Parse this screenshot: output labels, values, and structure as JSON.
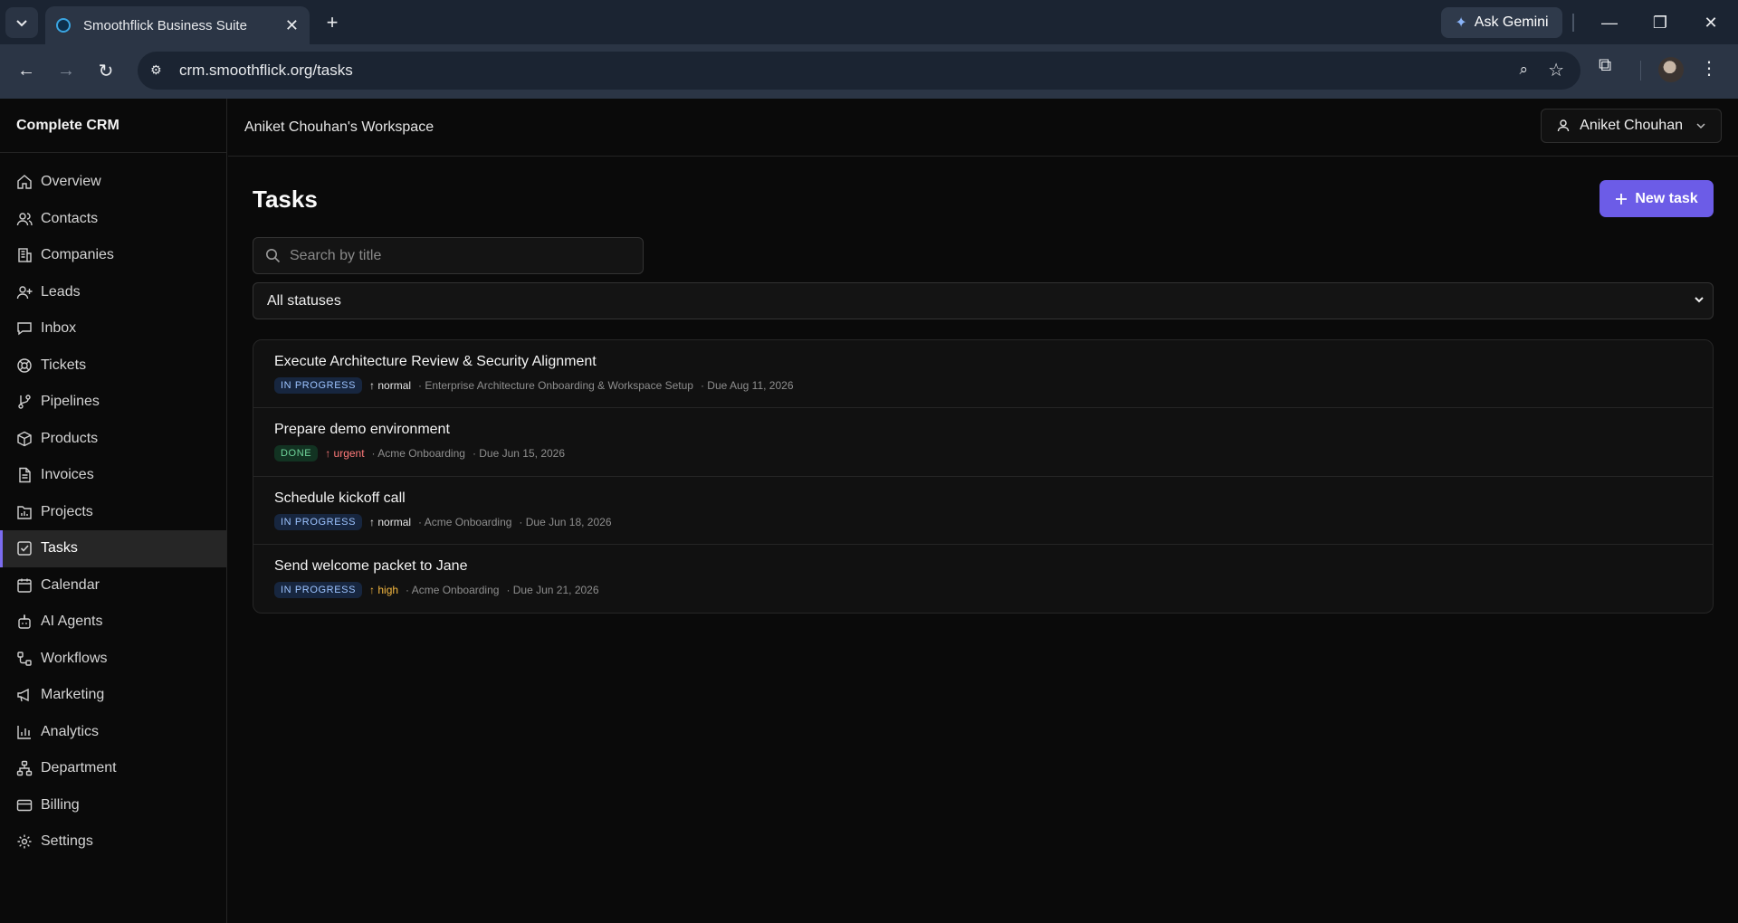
{
  "browser": {
    "tab_title": "Smoothflick Business Suite",
    "url": "crm.smoothflick.org/tasks",
    "gemini_label": "Ask Gemini"
  },
  "sidebar": {
    "brand": "Complete CRM",
    "items": [
      {
        "label": "Overview",
        "icon": "home-icon"
      },
      {
        "label": "Contacts",
        "icon": "users-icon"
      },
      {
        "label": "Companies",
        "icon": "building-icon"
      },
      {
        "label": "Leads",
        "icon": "user-plus-icon"
      },
      {
        "label": "Inbox",
        "icon": "message-icon"
      },
      {
        "label": "Tickets",
        "icon": "lifebuoy-icon"
      },
      {
        "label": "Pipelines",
        "icon": "git-branch-icon"
      },
      {
        "label": "Products",
        "icon": "package-icon"
      },
      {
        "label": "Invoices",
        "icon": "file-text-icon"
      },
      {
        "label": "Projects",
        "icon": "folder-chart-icon"
      },
      {
        "label": "Tasks",
        "icon": "check-square-icon"
      },
      {
        "label": "Calendar",
        "icon": "calendar-icon"
      },
      {
        "label": "AI Agents",
        "icon": "bot-icon"
      },
      {
        "label": "Workflows",
        "icon": "workflow-icon"
      },
      {
        "label": "Marketing",
        "icon": "megaphone-icon"
      },
      {
        "label": "Analytics",
        "icon": "bar-chart-icon"
      },
      {
        "label": "Department",
        "icon": "network-icon"
      },
      {
        "label": "Billing",
        "icon": "credit-card-icon"
      },
      {
        "label": "Settings",
        "icon": "gear-icon"
      }
    ],
    "active": "Tasks"
  },
  "topbar": {
    "workspace": "Aniket Chouhan's Workspace",
    "user_name": "Aniket Chouhan"
  },
  "main": {
    "title": "Tasks",
    "new_task_label": "New task",
    "search_placeholder": "Search by title",
    "status_filter": "All statuses"
  },
  "tasks": [
    {
      "title": "Execute Architecture Review & Security Alignment",
      "status": "IN PROGRESS",
      "priority": "↑ normal",
      "project": "· Enterprise Architecture Onboarding & Workspace Setup",
      "due": "· Due Aug 11, 2026"
    },
    {
      "title": "Prepare demo environment",
      "status": "DONE",
      "priority": "↑ urgent",
      "project": "· Acme Onboarding",
      "due": "· Due Jun 15, 2026"
    },
    {
      "title": "Schedule kickoff call",
      "status": "IN PROGRESS",
      "priority": "↑ normal",
      "project": "· Acme Onboarding",
      "due": "· Due Jun 18, 2026"
    },
    {
      "title": "Send welcome packet to Jane",
      "status": "IN PROGRESS",
      "priority": "↑ high",
      "project": "· Acme Onboarding",
      "due": "· Due Jun 21, 2026"
    }
  ],
  "colors": {
    "accent": "#6c5ce7",
    "in_progress": "#9cc3ff",
    "done": "#6fd39a",
    "urgent": "#ff7a7a",
    "high": "#f5b840"
  }
}
